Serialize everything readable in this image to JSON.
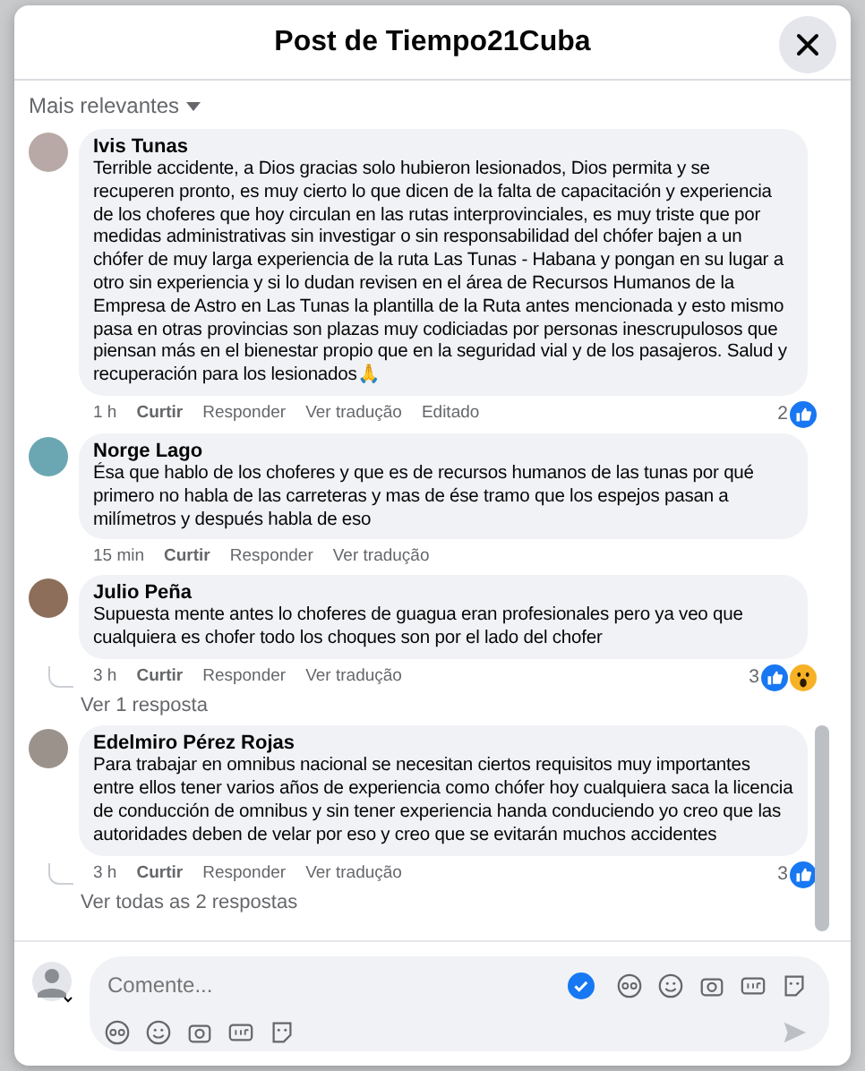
{
  "dialog": {
    "title": "Post de Tiempo21Cuba"
  },
  "sort": {
    "label": "Mais relevantes"
  },
  "comments": [
    {
      "author": "Ivis Tunas",
      "text": "Terrible accidente, a Dios gracias solo hubieron lesionados, Dios permita y se recuperen pronto, es muy cierto lo que dicen de la falta de capacitación y experiencia de los choferes que hoy circulan en las rutas interprovinciales, es muy triste que por medidas administrativas sin investigar o sin responsabilidad del chófer bajen a un chófer de muy larga experiencia de la ruta Las Tunas - Habana y pongan en su lugar a otro sin experiencia y si lo dudan revisen en el área de Recursos Humanos de la Empresa de Astro en Las Tunas la plantilla de la Ruta antes mencionada y esto mismo pasa en otras provincias son plazas muy codiciadas por personas inescrupulosos que piensan más en el bienestar propio que en la seguridad vial y de los pasajeros. Salud y recuperación para los lesionados🙏",
      "time": "1 h",
      "actions": [
        "Curtir",
        "Responder",
        "Ver tradução"
      ],
      "edited_label": "Editado",
      "reaction_count": "2",
      "reactions": [
        {
          "kind": "like"
        }
      ]
    },
    {
      "author": "Norge Lago",
      "text": "Ésa que hablo de los choferes y que es de recursos humanos de las tunas por qué primero no habla de las carreteras y mas de ése tramo que los espejos pasan a milímetros y después habla de eso",
      "time": "15 min",
      "actions": [
        "Curtir",
        "Responder",
        "Ver tradução"
      ]
    },
    {
      "author": "Julio Peña",
      "text": "Supuesta mente antes lo choferes de guagua eran profesionales pero ya veo que cualquiera es chofer todo los choques son por el lado del chofer",
      "time": "3 h",
      "actions": [
        "Curtir",
        "Responder",
        "Ver tradução"
      ],
      "reaction_count": "3",
      "reactions": [
        {
          "kind": "like"
        },
        {
          "kind": "wow"
        }
      ],
      "replies_link": "Ver 1 resposta"
    },
    {
      "author": "Edelmiro Pérez Rojas",
      "text": "Para trabajar en omnibus nacional se necesitan ciertos requisitos muy importantes entre ellos tener varios años de experiencia como chófer hoy cualquiera saca la licencia de conducción de omnibus y sin tener experiencia handa conduciendo yo creo que las autoridades deben de velar por eso y creo que se evitarán muchos accidentes",
      "time": "3 h",
      "actions": [
        "Curtir",
        "Responder",
        "Ver tradução"
      ],
      "reaction_count": "3",
      "reactions": [
        {
          "kind": "like"
        }
      ],
      "replies_link": "Ver todas as 2 respostas"
    }
  ],
  "composer": {
    "placeholder": "Comente..."
  }
}
